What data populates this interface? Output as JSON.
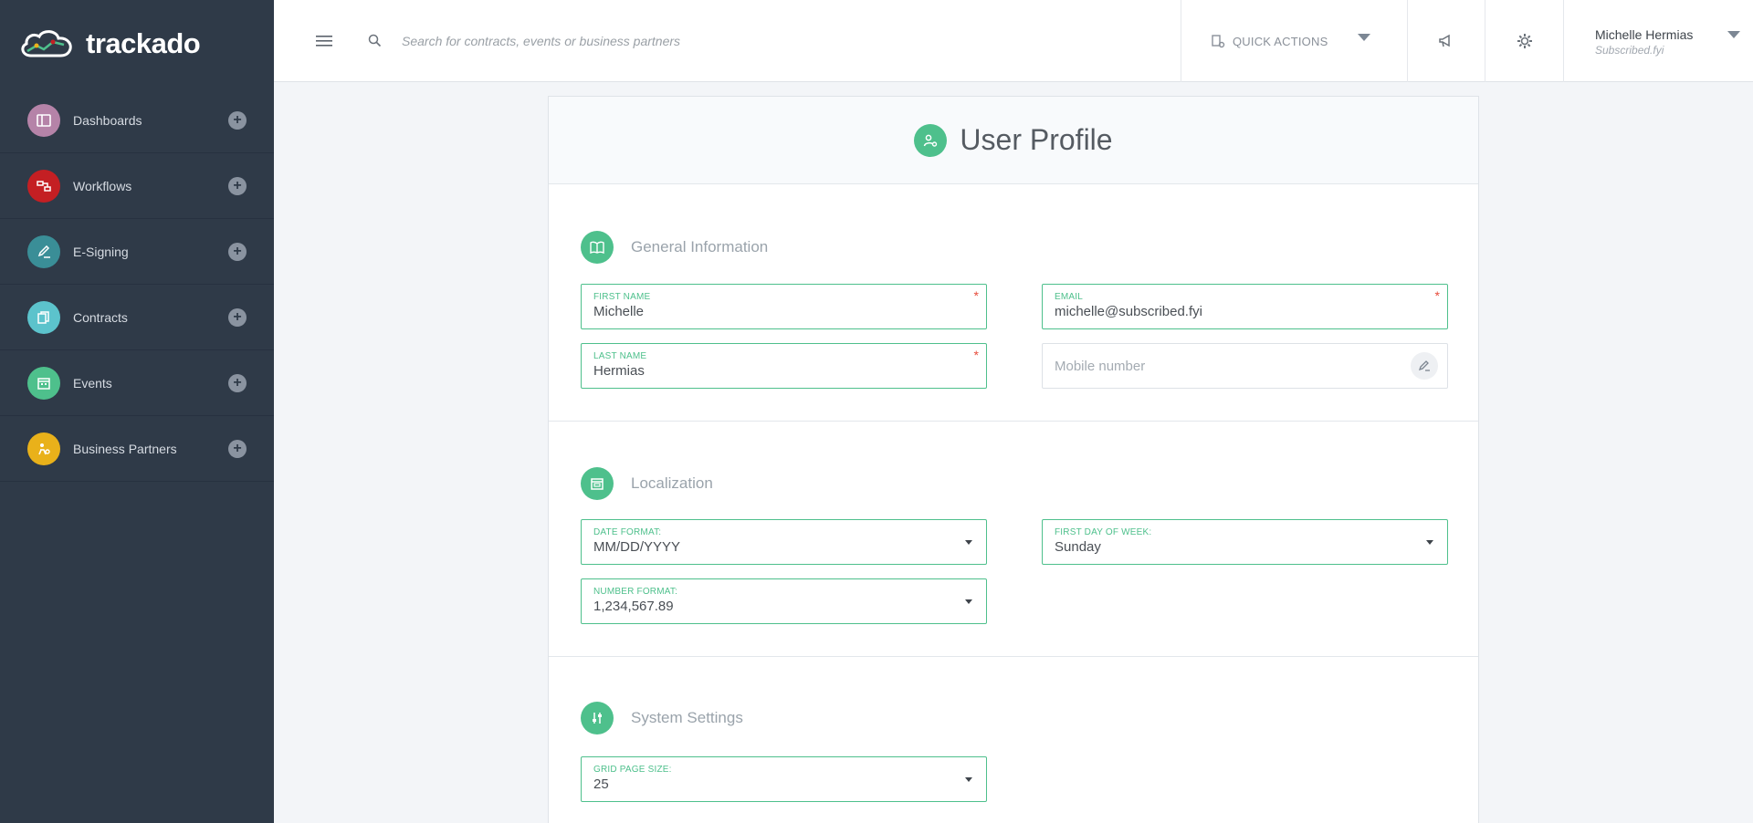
{
  "app": {
    "logo_text": "trackado"
  },
  "sidebar": {
    "items": [
      {
        "label": "Dashboards",
        "color": "#b583a8",
        "icon": "dashboard-icon"
      },
      {
        "label": "Workflows",
        "color": "#c41f23",
        "icon": "workflow-icon"
      },
      {
        "label": "E-Signing",
        "color": "#3a8e97",
        "icon": "pen-icon"
      },
      {
        "label": "Contracts",
        "color": "#5cc3cc",
        "icon": "contracts-icon"
      },
      {
        "label": "Events",
        "color": "#4ec08c",
        "icon": "calendar-icon"
      },
      {
        "label": "Business Partners",
        "color": "#e9b11a",
        "icon": "partners-icon"
      }
    ],
    "add_symbol": "+"
  },
  "topbar": {
    "search_placeholder": "Search for contracts, events or business partners",
    "quick_actions_label": "QUICK ACTIONS",
    "user": {
      "name": "Michelle Hermias",
      "subtitle": "Subscribed.fyi"
    }
  },
  "profile": {
    "title": "User Profile",
    "general": {
      "title": "General Information",
      "first_name_label": "FIRST NAME",
      "first_name": "Michelle",
      "last_name_label": "LAST NAME",
      "last_name": "Hermias",
      "email_label": "EMAIL",
      "email": "michelle@subscribed.fyi",
      "mobile_placeholder": "Mobile number",
      "required_mark": "*"
    },
    "localization": {
      "title": "Localization",
      "date_format_label": "DATE FORMAT:",
      "date_format": "MM/DD/YYYY",
      "first_day_label": "FIRST DAY OF WEEK:",
      "first_day": "Sunday",
      "number_format_label": "NUMBER FORMAT:",
      "number_format": "1,234,567.89"
    },
    "system": {
      "title": "System Settings",
      "grid_page_size_label": "GRID PAGE SIZE:",
      "grid_page_size": "25"
    }
  },
  "colors": {
    "accent": "#4ec08c",
    "sidebar_bg": "#2f3a48",
    "required": "#e74c3c"
  }
}
